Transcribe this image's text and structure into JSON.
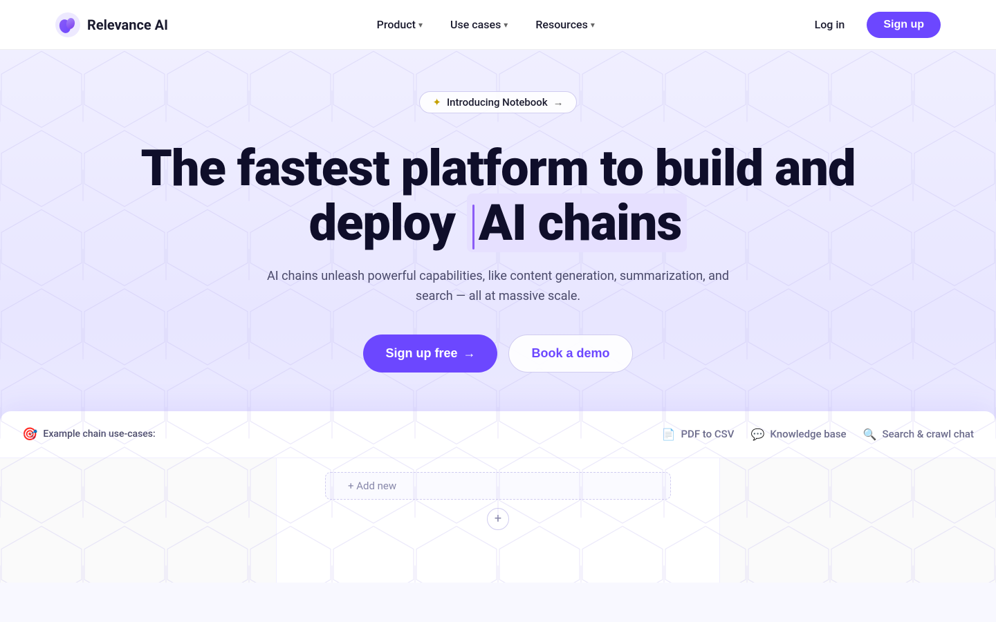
{
  "nav": {
    "logo_text": "Relevance AI",
    "items": [
      {
        "label": "Product",
        "has_dropdown": true
      },
      {
        "label": "Use cases",
        "has_dropdown": true
      },
      {
        "label": "Resources",
        "has_dropdown": true
      }
    ],
    "login_label": "Log in",
    "signup_label": "Sign up"
  },
  "hero": {
    "badge_text": "Introducing Notebook",
    "badge_spark": "✦",
    "badge_arrow": "→",
    "headline_part1": "The fastest platform to build and",
    "headline_part2": "deploy ",
    "headline_highlight": "AI chains",
    "subtext": "AI chains unleash powerful capabilities, like content generation, summarization, and search — all at massive scale.",
    "cta_primary": "Sign up free",
    "cta_primary_arrow": "→",
    "cta_secondary": "Book a demo"
  },
  "demo_card": {
    "label_icon": "🎯",
    "label_text": "Example chain use-cases:",
    "tabs": [
      {
        "icon": "📄",
        "label": "PDF to CSV"
      },
      {
        "icon": "💬",
        "label": "Knowledge base"
      },
      {
        "icon": "🔍",
        "label": "Search & crawl chat"
      }
    ],
    "add_new_label": "+ Add new",
    "plus_circle": "+"
  },
  "colors": {
    "brand_purple": "#6c47ff",
    "light_purple_bg": "#e8e6ff",
    "highlight_bar": "#8b5cf6"
  }
}
